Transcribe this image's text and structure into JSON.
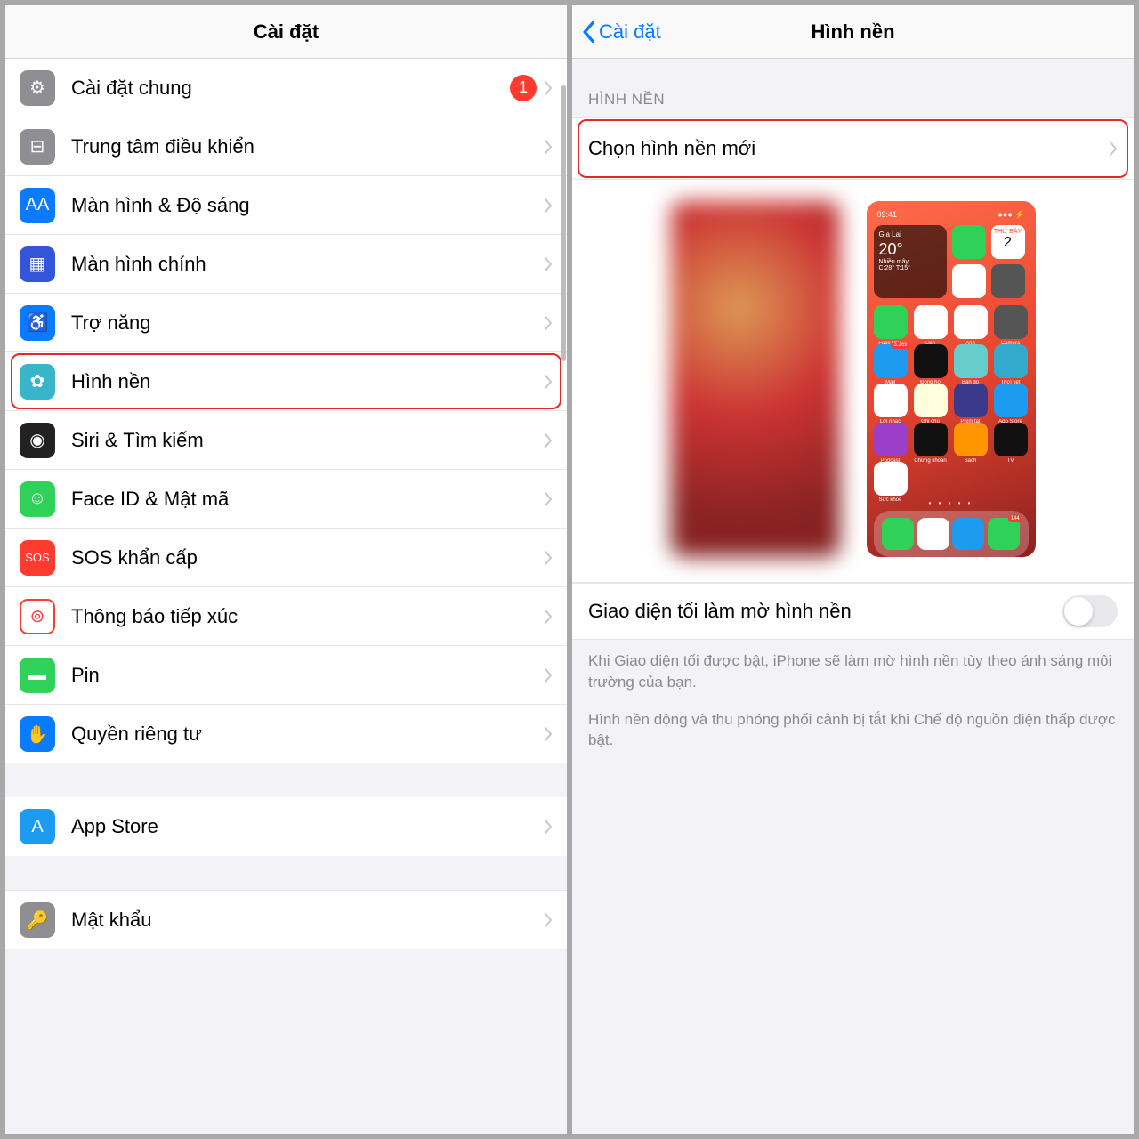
{
  "left": {
    "title": "Cài đặt",
    "items": [
      {
        "key": "general",
        "label": "Cài đặt chung",
        "badge": "1",
        "iconBg": "#8e8e93",
        "iconGlyph": "⚙"
      },
      {
        "key": "control",
        "label": "Trung tâm điều khiển",
        "iconBg": "#8e8e93",
        "iconGlyph": "⊟"
      },
      {
        "key": "display",
        "label": "Màn hình & Độ sáng",
        "iconBg": "#0a7aff",
        "iconGlyph": "AA"
      },
      {
        "key": "home",
        "label": "Màn hình chính",
        "iconBg": "#3355d8",
        "iconGlyph": "▦"
      },
      {
        "key": "access",
        "label": "Trợ năng",
        "iconBg": "#0a7aff",
        "iconGlyph": "♿"
      },
      {
        "key": "wallpaper",
        "label": "Hình nền",
        "iconBg": "#39b5c9",
        "iconGlyph": "✿",
        "highlight": true
      },
      {
        "key": "siri",
        "label": "Siri & Tìm kiếm",
        "iconBg": "#222",
        "iconGlyph": "◉"
      },
      {
        "key": "faceid",
        "label": "Face ID & Mật mã",
        "iconBg": "#30d158",
        "iconGlyph": "☺"
      },
      {
        "key": "sos",
        "label": "SOS khẩn cấp",
        "iconBg": "#ff3b30",
        "iconGlyph": "SOS",
        "small": true
      },
      {
        "key": "exposure",
        "label": "Thông báo tiếp xúc",
        "iconBg": "#fff",
        "iconBorder": "#ff3b30",
        "iconGlyph": "⊚",
        "iconColor": "#ff3b30"
      },
      {
        "key": "battery",
        "label": "Pin",
        "iconBg": "#30d158",
        "iconGlyph": "▬"
      },
      {
        "key": "privacy",
        "label": "Quyền riêng tư",
        "iconBg": "#0a7aff",
        "iconGlyph": "✋"
      }
    ],
    "items2": [
      {
        "key": "appstore",
        "label": "App Store",
        "iconBg": "#1d9bf0",
        "iconGlyph": "A"
      }
    ],
    "items3": [
      {
        "key": "passwords",
        "label": "Mật khẩu",
        "iconBg": "#8e8e93",
        "iconGlyph": "🔑"
      }
    ]
  },
  "right": {
    "back": "Cài đặt",
    "title": "Hình nền",
    "sectionHeader": "HÌNH NỀN",
    "choose": "Chọn hình nền mới",
    "toggleLabel": "Giao diện tối làm mờ hình nền",
    "footer1": "Khi Giao diện tối được bật, iPhone sẽ làm mờ hình nền tùy theo ánh sáng môi trường của bạn.",
    "footer2": "Hình nền động và thu phóng phối cảnh bị tắt khi Chế độ nguồn điện thấp được bật.",
    "home": {
      "time": "09:41",
      "loc": "Gia Lai",
      "temp": "20°",
      "cond": "Nhiều mây",
      "range": "C:28° T:15°",
      "day": "THỨ BẢY",
      "daynum": "2",
      "apps": [
        {
          "l": "FaceTime",
          "c": "#30d158"
        },
        {
          "l": "Lịch",
          "c": "#fff"
        },
        {
          "l": "Ảnh",
          "c": "#fff"
        },
        {
          "l": "Camera",
          "c": "#555"
        },
        {
          "l": "Mail",
          "c": "#1d9bf0",
          "b": "3.269"
        },
        {
          "l": "Đồng hồ",
          "c": "#111"
        },
        {
          "l": "Bản đồ",
          "c": "#6cc"
        },
        {
          "l": "Thời tiết",
          "c": "#3ac"
        },
        {
          "l": "Lời nhắc",
          "c": "#fff"
        },
        {
          "l": "Ghi chú",
          "c": "#ffd"
        },
        {
          "l": "Phím tắt",
          "c": "#3a3a8a"
        },
        {
          "l": "App Store",
          "c": "#1d9bf0"
        },
        {
          "l": "Podcast",
          "c": "#9b3ec9"
        },
        {
          "l": "Chứng khoán",
          "c": "#111"
        },
        {
          "l": "Sách",
          "c": "#ff9500"
        },
        {
          "l": "TV",
          "c": "#111"
        },
        {
          "l": "Sức khỏe",
          "c": "#fff"
        }
      ],
      "dock": [
        {
          "c": "#30d158"
        },
        {
          "c": "#fff"
        },
        {
          "c": "#1d9bf0"
        },
        {
          "c": "#30d158",
          "b": "144"
        }
      ]
    }
  }
}
